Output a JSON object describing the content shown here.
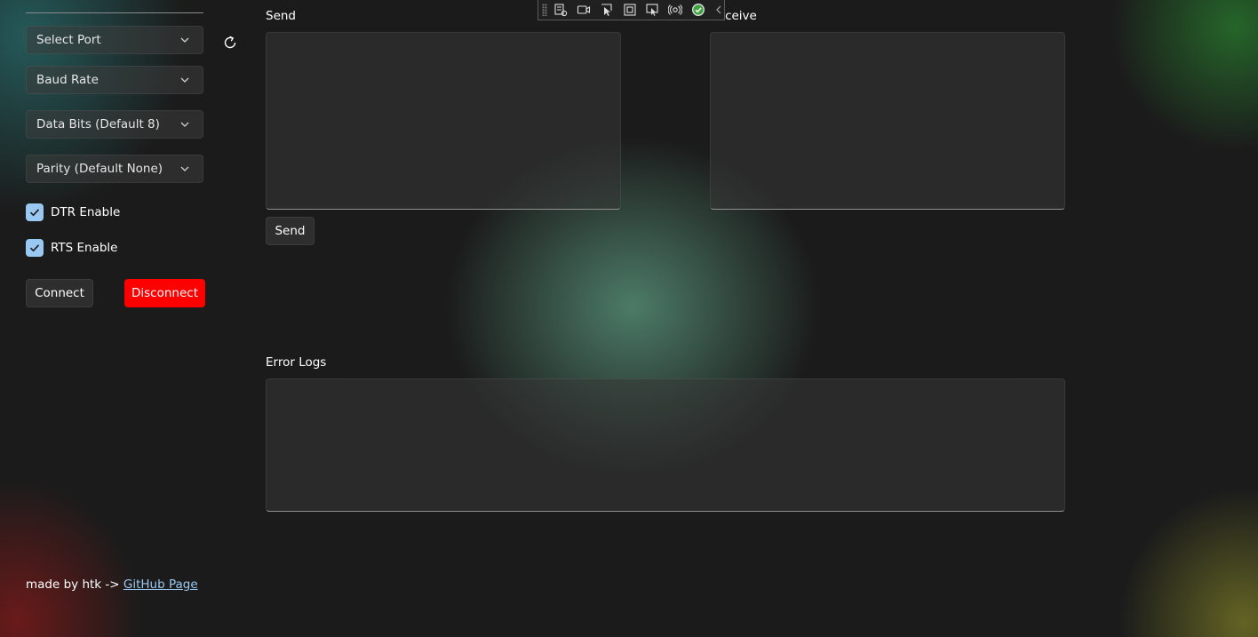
{
  "sidebar": {
    "port_combo": "Select Port",
    "baud_combo": "Baud Rate",
    "databits_combo": "Data Bits (Default 8)",
    "parity_combo": "Parity (Default None)",
    "dtr_label": "DTR Enable",
    "rts_label": "RTS Enable",
    "dtr_checked": true,
    "rts_checked": true,
    "connect_label": "Connect",
    "disconnect_label": "Disconnect"
  },
  "main": {
    "send_label": "Send",
    "send_value": "",
    "receive_label": "Receive",
    "receive_value": "",
    "send_button_label": "Send",
    "error_label": "Error Logs",
    "error_value": ""
  },
  "footer": {
    "text": "made by htk -> ",
    "link_text": "GitHub Page"
  },
  "icons": {
    "refresh": "refresh-icon",
    "chevron": "chevron-down-icon",
    "check": "checkmark-icon"
  },
  "colors": {
    "accent": "#99c9f2",
    "disconnect": "#ff0000",
    "background": "#1b1b1b"
  }
}
